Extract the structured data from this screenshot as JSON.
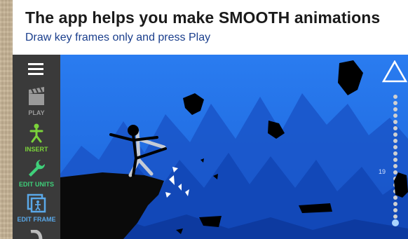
{
  "header": {
    "title": "The app helps you make SMOOTH animations",
    "subtitle": "Draw key frames only and press Play"
  },
  "sidebar": {
    "items": [
      {
        "label": "PLAY",
        "icon": "clapperboard-icon",
        "color": "#9a9a9a"
      },
      {
        "label": "INSERT",
        "icon": "stickman-add-icon",
        "color": "#7bd33a"
      },
      {
        "label": "EDIT UNITS",
        "icon": "wrench-icon",
        "color": "#3fd07a"
      },
      {
        "label": "EDIT FRAME",
        "icon": "frame-edit-icon",
        "color": "#5aa8e8"
      }
    ]
  },
  "timeline": {
    "frame_number": "19"
  },
  "colors": {
    "sky": "#1f6fe8",
    "sidebar": "#3a3a3a",
    "title_text": "#1a1a1a",
    "subtitle_text": "#1a3e8c"
  }
}
